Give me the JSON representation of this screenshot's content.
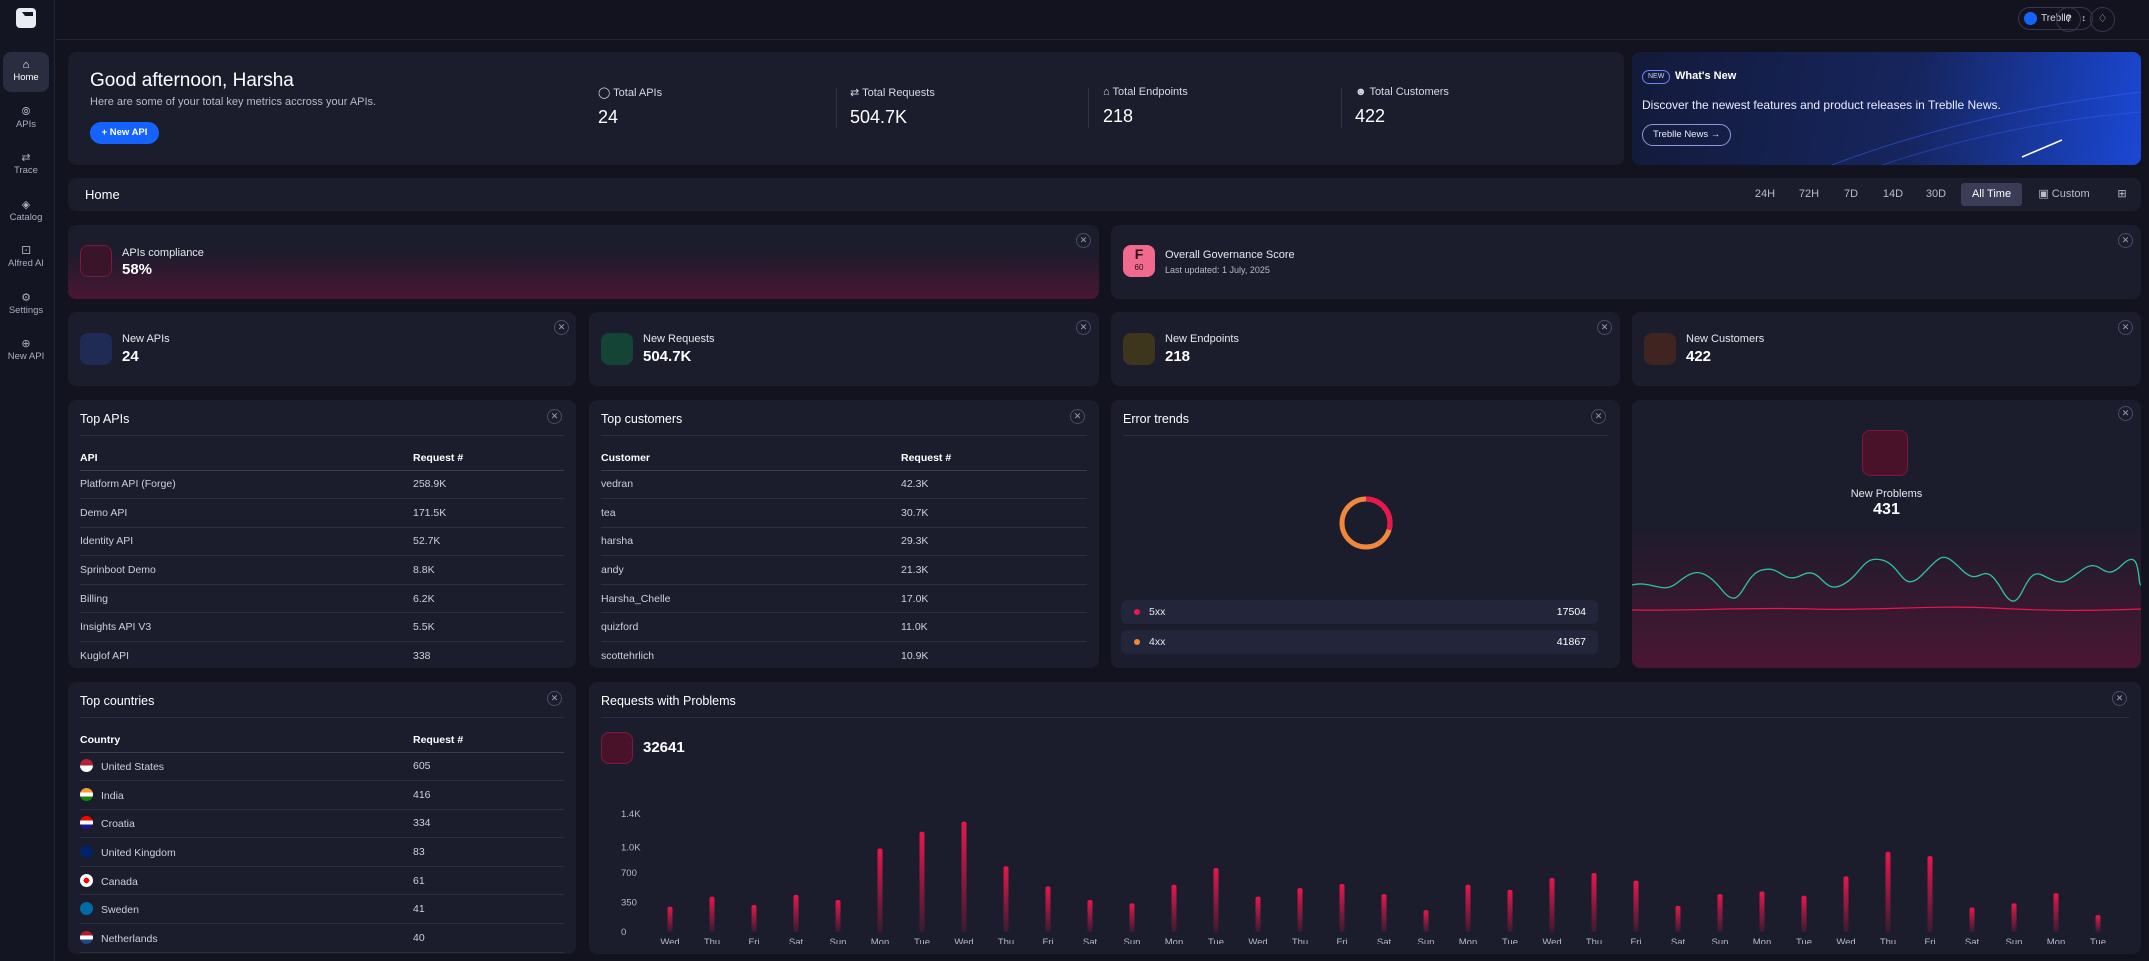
{
  "nav": [
    {
      "label": "Home",
      "icon": "home-icon"
    },
    {
      "label": "APIs",
      "icon": "apis-icon"
    },
    {
      "label": "Trace",
      "icon": "trace-icon"
    },
    {
      "label": "Catalog",
      "icon": "catalog-icon"
    },
    {
      "label": "Alfred AI",
      "icon": "robot-icon"
    },
    {
      "label": "Settings",
      "icon": "gear-icon"
    },
    {
      "label": "New API",
      "icon": "plus-icon"
    }
  ],
  "topbar": {
    "workspace": "Treblle",
    "help": "?"
  },
  "welcome": {
    "greeting": "Good afternoon, Harsha",
    "subtitle": "Here are some of your total key metrics accross your APIs.",
    "new_api": "+ New API"
  },
  "metrics": [
    {
      "label": "Total APIs",
      "value": "24"
    },
    {
      "label": "Total Requests",
      "value": "504.7K"
    },
    {
      "label": "Total Endpoints",
      "value": "218"
    },
    {
      "label": "Total Customers",
      "value": "422"
    }
  ],
  "news": {
    "badge": "NEW",
    "title": "What's New",
    "text": "Discover the newest features and product releases in Treblle News.",
    "button": "Treblle News →"
  },
  "homebar": {
    "title": "Home",
    "ranges": [
      "24H",
      "72H",
      "7D",
      "14D",
      "30D",
      "All Time"
    ],
    "selected": "All Time",
    "custom": "Custom"
  },
  "compliance": {
    "label": "APIs compliance",
    "value": "58%"
  },
  "governance": {
    "grade": "F",
    "score": "60",
    "label": "Overall Governance Score",
    "updated": "Last updated: 1 July, 2025"
  },
  "kpis": [
    {
      "label": "New APIs",
      "value": "24"
    },
    {
      "label": "New Requests",
      "value": "504.7K"
    },
    {
      "label": "New Endpoints",
      "value": "218"
    },
    {
      "label": "New Customers",
      "value": "422"
    }
  ],
  "top_apis": {
    "title": "Top APIs",
    "columns": [
      "API",
      "Request #"
    ],
    "rows": [
      [
        "Platform API (Forge)",
        "258.9K"
      ],
      [
        "Demo API",
        "171.5K"
      ],
      [
        "Identity API",
        "52.7K"
      ],
      [
        "Sprinboot Demo",
        "8.8K"
      ],
      [
        "Billing",
        "6.2K"
      ],
      [
        "Insights API V3",
        "5.5K"
      ],
      [
        "Kuglof API",
        "338"
      ]
    ]
  },
  "top_customers": {
    "title": "Top customers",
    "columns": [
      "Customer",
      "Request #"
    ],
    "rows": [
      [
        "vedran",
        "42.3K"
      ],
      [
        "tea",
        "30.7K"
      ],
      [
        "harsha",
        "29.3K"
      ],
      [
        "andy",
        "21.3K"
      ],
      [
        "Harsha_Chelle",
        "17.0K"
      ],
      [
        "quizford",
        "11.0K"
      ],
      [
        "scottehrlich",
        "10.9K"
      ]
    ]
  },
  "error_trends": {
    "title": "Error trends",
    "items": [
      {
        "label": "5xx",
        "value": "17504",
        "color": "#e8174c"
      },
      {
        "label": "4xx",
        "value": "41867",
        "color": "#f0873a"
      }
    ]
  },
  "problems": {
    "label": "New Problems",
    "value": "431"
  },
  "top_countries": {
    "title": "Top countries",
    "columns": [
      "Country",
      "Request #"
    ],
    "rows": [
      [
        "United States",
        "605"
      ],
      [
        "India",
        "416"
      ],
      [
        "Croatia",
        "334"
      ],
      [
        "United Kingdom",
        "83"
      ],
      [
        "Canada",
        "61"
      ],
      [
        "Sweden",
        "41"
      ],
      [
        "Netherlands",
        "40"
      ]
    ]
  },
  "requests_problems": {
    "title": "Requests with Problems",
    "total": "32641"
  },
  "chart_data": {
    "type": "bar",
    "title": "Requests with Problems",
    "yticks": [
      "1.4K",
      "1.0K",
      "700",
      "350",
      "0"
    ],
    "ylim": [
      0,
      1400
    ],
    "categories": [
      "Wed",
      "Thu",
      "Fri",
      "Sat",
      "Sun",
      "Mon",
      "Tue",
      "Wed",
      "Thu",
      "Fri",
      "Sat",
      "Sun",
      "Mon",
      "Tue",
      "Wed",
      "Thu",
      "Fri",
      "Sat",
      "Sun",
      "Mon",
      "Tue",
      "Wed",
      "Thu",
      "Fri",
      "Sat",
      "Sun",
      "Mon",
      "Tue",
      "Wed",
      "Thu",
      "Fri",
      "Sat",
      "Sun",
      "Mon",
      "Tue"
    ],
    "values": [
      300,
      420,
      320,
      440,
      380,
      990,
      1190,
      1310,
      780,
      540,
      380,
      340,
      560,
      760,
      420,
      520,
      570,
      450,
      260,
      560,
      500,
      640,
      700,
      610,
      310,
      450,
      480,
      430,
      660,
      950,
      900,
      290,
      340,
      460,
      200
    ],
    "color": "#e8174c"
  }
}
